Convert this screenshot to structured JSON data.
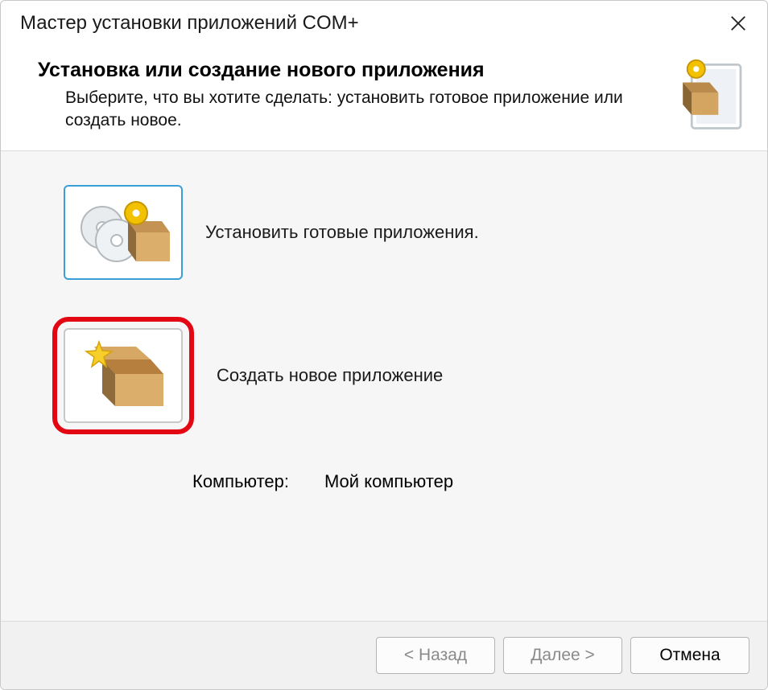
{
  "window": {
    "title": "Мастер установки приложений COM+"
  },
  "header": {
    "heading": "Установка или создание нового приложения",
    "description": "Выберите, что вы хотите сделать: установить готовое приложение или создать новое."
  },
  "options": {
    "install": {
      "label": "Установить готовые приложения."
    },
    "create": {
      "label": "Создать новое приложение"
    }
  },
  "computer": {
    "label": "Компьютер:",
    "value": "Мой компьютер"
  },
  "buttons": {
    "back": "< Назад",
    "next": "Далее >",
    "cancel": "Отмена"
  }
}
